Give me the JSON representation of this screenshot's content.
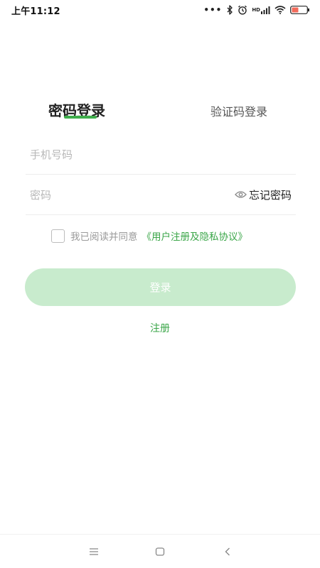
{
  "status_bar": {
    "time": "上午11:12",
    "dots": "•••",
    "network_label": "HD",
    "accent_color": "#3fae4c"
  },
  "tabs": {
    "active_label": "密码登录",
    "inactive_label": "验证码登录"
  },
  "form": {
    "phone_placeholder": "手机号码",
    "password_placeholder": "密码",
    "forgot_label": "忘记密码"
  },
  "agreement": {
    "text": "我已阅读并同意",
    "link": "《用户注册及隐私协议》",
    "checked": false
  },
  "login_button": {
    "label": "登录",
    "color": "#c8ebcd"
  },
  "register": {
    "label": "注册"
  },
  "nav_bar": {
    "icons": [
      "menu-icon",
      "home-icon",
      "back-icon"
    ]
  }
}
